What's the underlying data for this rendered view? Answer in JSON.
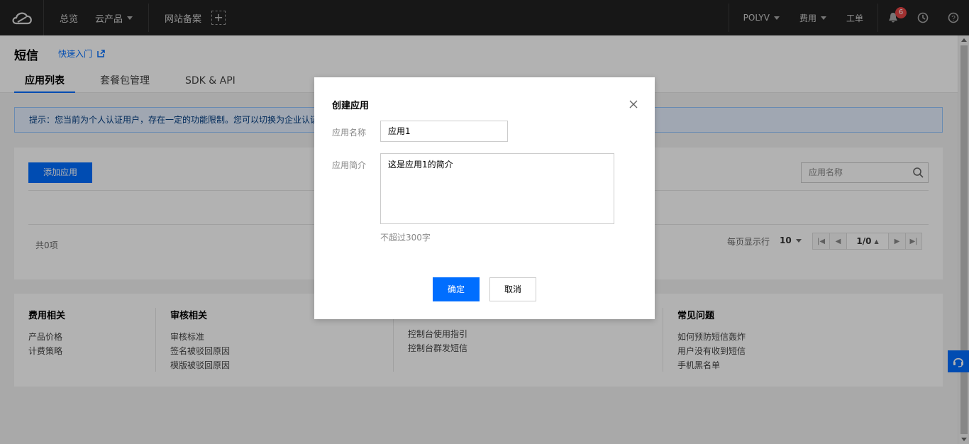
{
  "topbar": {
    "nav": {
      "overview": "总览",
      "products": "云产品",
      "icp": "网站备案"
    },
    "right": {
      "account": "POLYV",
      "billing": "费用",
      "ticket": "工单",
      "notifications_count": "6"
    }
  },
  "header": {
    "title": "短信",
    "quick_start": "快速入门",
    "tabs": [
      "应用列表",
      "套餐包管理",
      "SDK & API"
    ]
  },
  "notice": {
    "text": "提示：您当前为个人认证用户，存在一定的功能限制。您可以切换为企业认证"
  },
  "panel": {
    "add_button": "添加应用",
    "search_placeholder": "应用名称",
    "total": "共0项",
    "per_page_label": "每页显示行",
    "per_page_value": "10",
    "page_indicator": "1/0"
  },
  "footer": {
    "col1": {
      "title": "费用相关",
      "links": [
        "产品价格",
        "计费策略"
      ]
    },
    "col2": {
      "title": "审核相关",
      "links": [
        "审核标准",
        "签名被驳回原因",
        "模版被驳回原因"
      ]
    },
    "col3": {
      "links": [
        "控制台使用指引",
        "控制台群发短信"
      ]
    },
    "col4": {
      "title": "常见问题",
      "links": [
        "如何预防短信轰炸",
        "用户没有收到短信",
        "手机黑名单"
      ]
    }
  },
  "modal": {
    "title": "创建应用",
    "name_label": "应用名称",
    "name_value": "应用1",
    "desc_label": "应用简介",
    "desc_value": "这是应用1的简介",
    "hint": "不超过300字",
    "confirm": "确定",
    "cancel": "取消"
  },
  "colors": {
    "accent": "#006eff",
    "topbar": "#222222",
    "badge": "#e54545"
  }
}
